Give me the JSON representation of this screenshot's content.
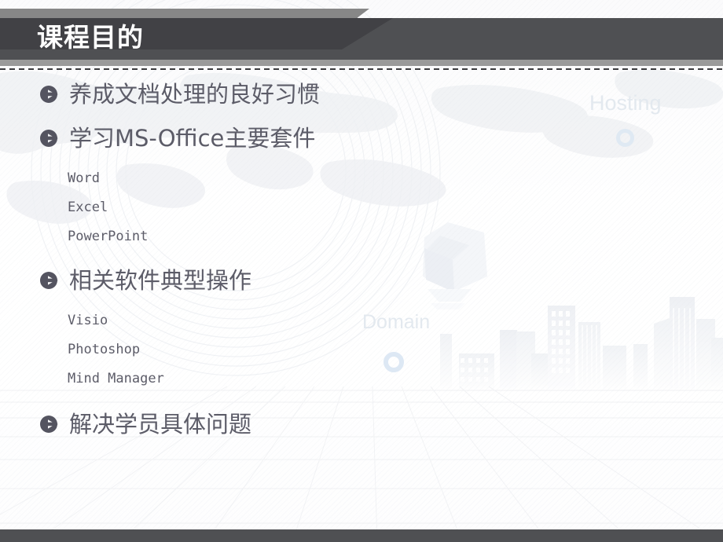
{
  "slide": {
    "title": "课程目的",
    "bullet_icon_name": "circle-arrow-bullet"
  },
  "outline": [
    {
      "level": 1,
      "text": "养成文档处理的良好习惯"
    },
    {
      "level": 1,
      "text": "学习MS-Office主要套件"
    },
    {
      "level": 2,
      "text": "Word"
    },
    {
      "level": 2,
      "text": "Excel"
    },
    {
      "level": 2,
      "text": "PowerPoint"
    },
    {
      "level": 1,
      "text": "相关软件典型操作"
    },
    {
      "level": 2,
      "text": "Visio"
    },
    {
      "level": 2,
      "text": "Photoshop"
    },
    {
      "level": 2,
      "text": "Mind Manager"
    },
    {
      "level": 1,
      "text": "解决学员具体问题"
    }
  ],
  "background": {
    "decorative_words": [
      {
        "id": "hosting",
        "text": "Hosting"
      },
      {
        "id": "domain",
        "text": "Domain"
      }
    ]
  },
  "colors": {
    "header_dark": "#414145",
    "header_band": "#4f5053",
    "header_gray_strip": "#878787",
    "header_underline": "#9a9a9a",
    "title_text": "#ffffff",
    "body_text": "#5c5c68",
    "decorative_word": "#e3e9ef",
    "ring_accent": "#dde8f4",
    "bottom_bar": "#4f5053",
    "slide_background": "#ffffff"
  }
}
